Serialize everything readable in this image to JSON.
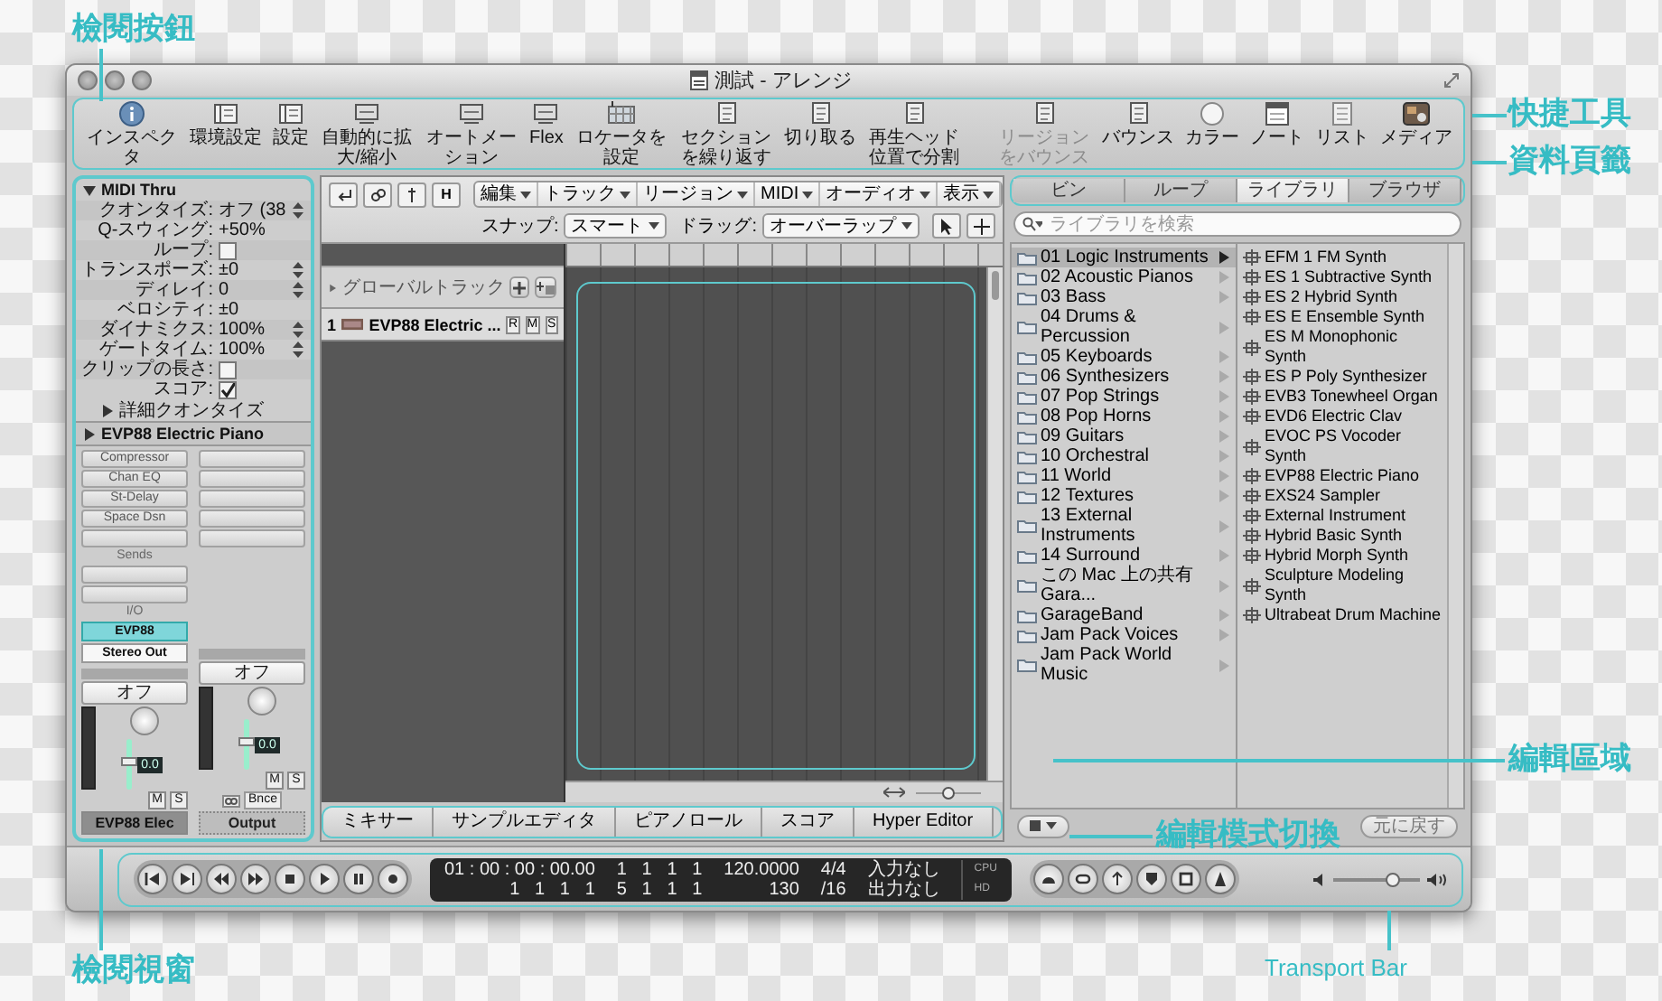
{
  "annotations": {
    "inspector_button": "檢閱按鈕",
    "shortcut_tools": "快捷工具",
    "library_tabs": "資料頁籤",
    "edit_area": "編輯區域",
    "edit_mode_switch": "編輯模式切換",
    "inspector_window": "檢閱視窗",
    "transport_bar": "Transport Bar"
  },
  "window": {
    "title": "測試 - アレンジ"
  },
  "toolbar": {
    "left": [
      {
        "label": "インスペクタ",
        "disabled": false
      },
      {
        "label": "環境設定",
        "disabled": false
      },
      {
        "label": "設定",
        "disabled": false
      },
      {
        "label": "自動的に拡大/縮小",
        "disabled": false
      },
      {
        "label": "オートメーション",
        "disabled": false
      },
      {
        "label": "Flex",
        "disabled": false
      },
      {
        "label": "ロケータを設定",
        "disabled": false
      },
      {
        "label": "セクションを繰り返す",
        "disabled": false
      },
      {
        "label": "切り取る",
        "disabled": false
      },
      {
        "label": "再生ヘッド位置で分割",
        "disabled": false
      }
    ],
    "right": [
      {
        "label": "リージョンをバウンス",
        "disabled": true
      },
      {
        "label": "バウンス",
        "disabled": false
      },
      {
        "label": "カラー",
        "disabled": false
      },
      {
        "label": "ノート",
        "disabled": false
      },
      {
        "label": "リスト",
        "disabled": false
      },
      {
        "label": "メディア",
        "disabled": false
      }
    ]
  },
  "inspector": {
    "region": {
      "title": "MIDI Thru",
      "expanded": true
    },
    "params": [
      {
        "kind": "stepper",
        "label": "クオンタイズ:",
        "value": "オフ (38"
      },
      {
        "kind": "value",
        "label": "Q-スウィング:",
        "value": "+50%"
      },
      {
        "kind": "checkbox",
        "label": "ループ:",
        "checked": false
      },
      {
        "kind": "stepper",
        "label": "トランスポーズ:",
        "value": "±0"
      },
      {
        "kind": "stepper",
        "label": "ディレイ:",
        "value": "0"
      },
      {
        "kind": "value",
        "label": "ベロシティ:",
        "value": "±0"
      },
      {
        "kind": "stepper",
        "label": "ダイナミクス:",
        "value": "100%"
      },
      {
        "kind": "stepper",
        "label": "ゲートタイム:",
        "value": "100%"
      },
      {
        "kind": "checkbox",
        "label": "クリップの長さ:",
        "checked": false
      },
      {
        "kind": "checkbox",
        "label": "スコア:",
        "checked": true
      }
    ],
    "advanced": {
      "label": "詳細クオンタイズ",
      "expanded": false
    },
    "track": {
      "title": "EVP88 Electric Piano",
      "expanded": false
    },
    "channel_strips": [
      {
        "inserts": [
          "Compressor",
          "Chan EQ",
          "St-Delay",
          "Space Dsn"
        ],
        "sends_label": "Sends",
        "io_label": "I/O",
        "input": {
          "label": "EVP88",
          "selected": true
        },
        "output": "Stereo Out",
        "automation": "オフ",
        "level": 0.55,
        "value": "0.0",
        "buttons": [
          "M",
          "S"
        ],
        "name": "EVP88 Elec",
        "selected": true
      },
      {
        "automation": "オフ",
        "level": 0.55,
        "value": "0.0",
        "buttons": [
          "M",
          "S"
        ],
        "bounce": "Bnce",
        "name": "Output",
        "selected": false
      }
    ]
  },
  "arrange": {
    "hyper_button": "H",
    "menus": [
      "編集",
      "トラック",
      "リージョン",
      "MIDI",
      "オーディオ",
      "表示"
    ],
    "snap": {
      "label": "スナップ:",
      "value": "スマート"
    },
    "drag": {
      "label": "ドラッグ:",
      "value": "オーバーラップ"
    },
    "global_tracks": {
      "label": "グローバルトラック",
      "expanded": false
    },
    "tracks": [
      {
        "number": "1",
        "name": "EVP88 Electric ...",
        "buttons": [
          "R",
          "M",
          "S"
        ]
      }
    ],
    "editor_tabs": [
      {
        "label": "ミキサー",
        "selected": false
      },
      {
        "label": "サンプルエディタ",
        "selected": false
      },
      {
        "label": "ピアノロール",
        "selected": false
      },
      {
        "label": "スコア",
        "selected": false
      },
      {
        "label": "Hyper Editor",
        "selected": false
      }
    ]
  },
  "library": {
    "tabs": [
      {
        "label": "ビン",
        "selected": false
      },
      {
        "label": "ループ",
        "selected": false
      },
      {
        "label": "ライブラリ",
        "selected": true
      },
      {
        "label": "ブラウザ",
        "selected": false
      }
    ],
    "search": {
      "placeholder": "ライブラリを検索"
    },
    "folders": [
      {
        "label": "01 Logic Instruments",
        "selected": true
      },
      {
        "label": "02 Acoustic Pianos",
        "selected": false
      },
      {
        "label": "03 Bass",
        "selected": false
      },
      {
        "label": "04 Drums & Percussion",
        "selected": false
      },
      {
        "label": "05 Keyboards",
        "selected": false
      },
      {
        "label": "06 Synthesizers",
        "selected": false
      },
      {
        "label": "07 Pop Strings",
        "selected": false
      },
      {
        "label": "08 Pop Horns",
        "selected": false
      },
      {
        "label": "09 Guitars",
        "selected": false
      },
      {
        "label": "10 Orchestral",
        "selected": false
      },
      {
        "label": "11 World",
        "selected": false
      },
      {
        "label": "12 Textures",
        "selected": false
      },
      {
        "label": "13 External Instruments",
        "selected": false
      },
      {
        "label": "14 Surround",
        "selected": false
      },
      {
        "label": "この Mac 上の共有 Gara...",
        "selected": false
      },
      {
        "label": "GarageBand",
        "selected": false
      },
      {
        "label": "Jam Pack Voices",
        "selected": false
      },
      {
        "label": "Jam Pack World Music",
        "selected": false
      }
    ],
    "instruments": [
      "EFM 1 FM Synth",
      "ES 1 Subtractive Synth",
      "ES 2 Hybrid Synth",
      "ES E Ensemble Synth",
      "ES M Monophonic Synth",
      "ES P Poly Synthesizer",
      "EVB3 Tonewheel Organ",
      "EVD6 Electric Clav",
      "EVOC PS Vocoder Synth",
      "EVP88 Electric Piano",
      "EXS24 Sampler",
      "External Instrument",
      "Hybrid Basic Synth",
      "Hybrid Morph Synth",
      "Sculpture Modeling Synth",
      "Ultrabeat Drum Machine"
    ],
    "revert_button": "元に戻す"
  },
  "transport": {
    "display": {
      "rows": [
        [
          "01 : 00 : 00 : 00.00",
          "1   1   1   1",
          "120.0000",
          "4/4",
          "入力なし"
        ],
        [
          "1   1   1   1",
          "5   1   1   1",
          "130",
          "/16",
          "出力なし"
        ]
      ],
      "meters": [
        "CPU",
        "HD"
      ]
    },
    "volume": {
      "level": 0.72
    }
  }
}
